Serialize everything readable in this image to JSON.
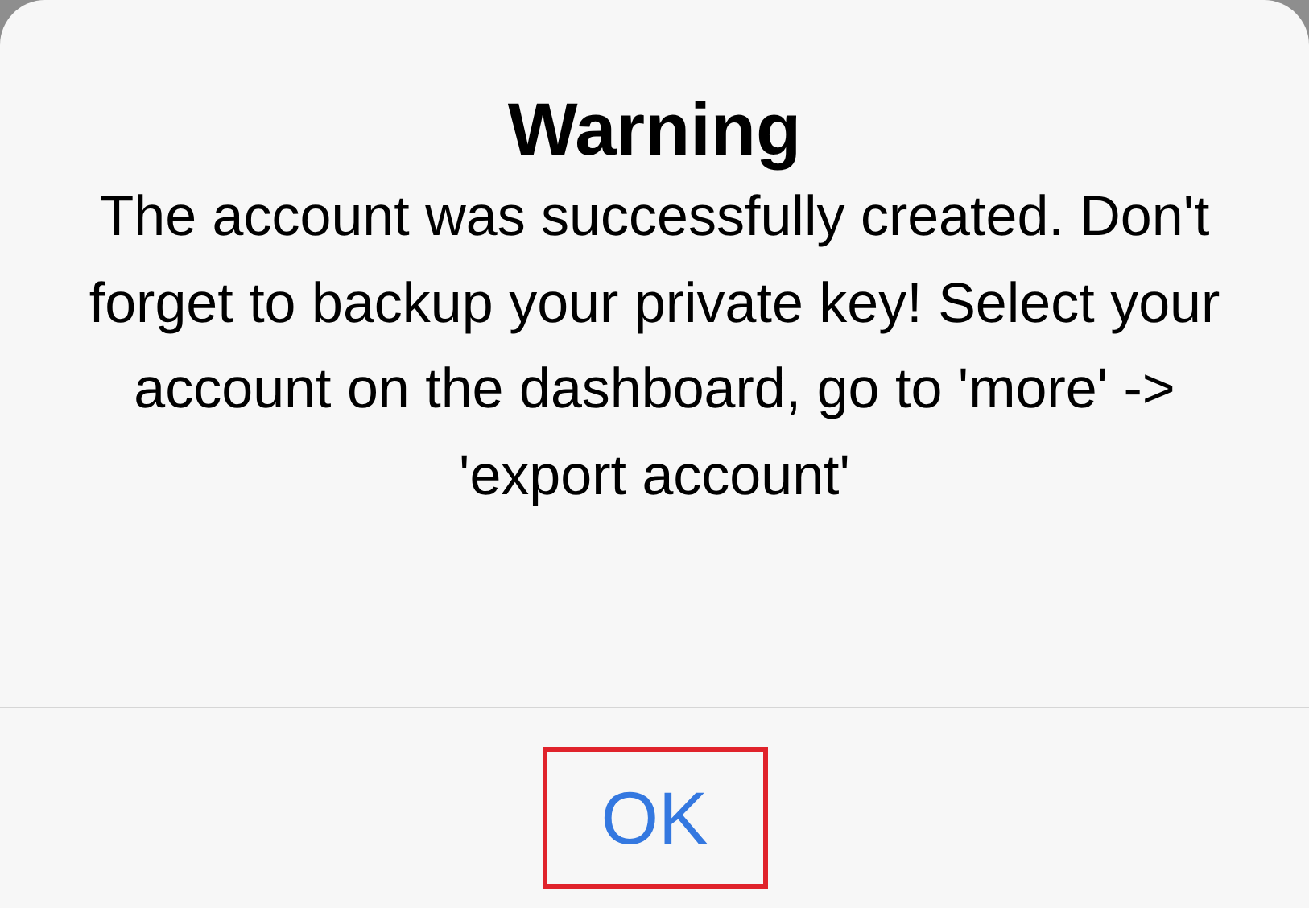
{
  "alert": {
    "title": "Warning",
    "message": "The account was successfully created. Don't forget to backup your private key! Select your account on the dashboard, go to 'more' -> 'export account'"
  },
  "buttons": [
    {
      "label": "OK",
      "highlighted": true
    }
  ]
}
